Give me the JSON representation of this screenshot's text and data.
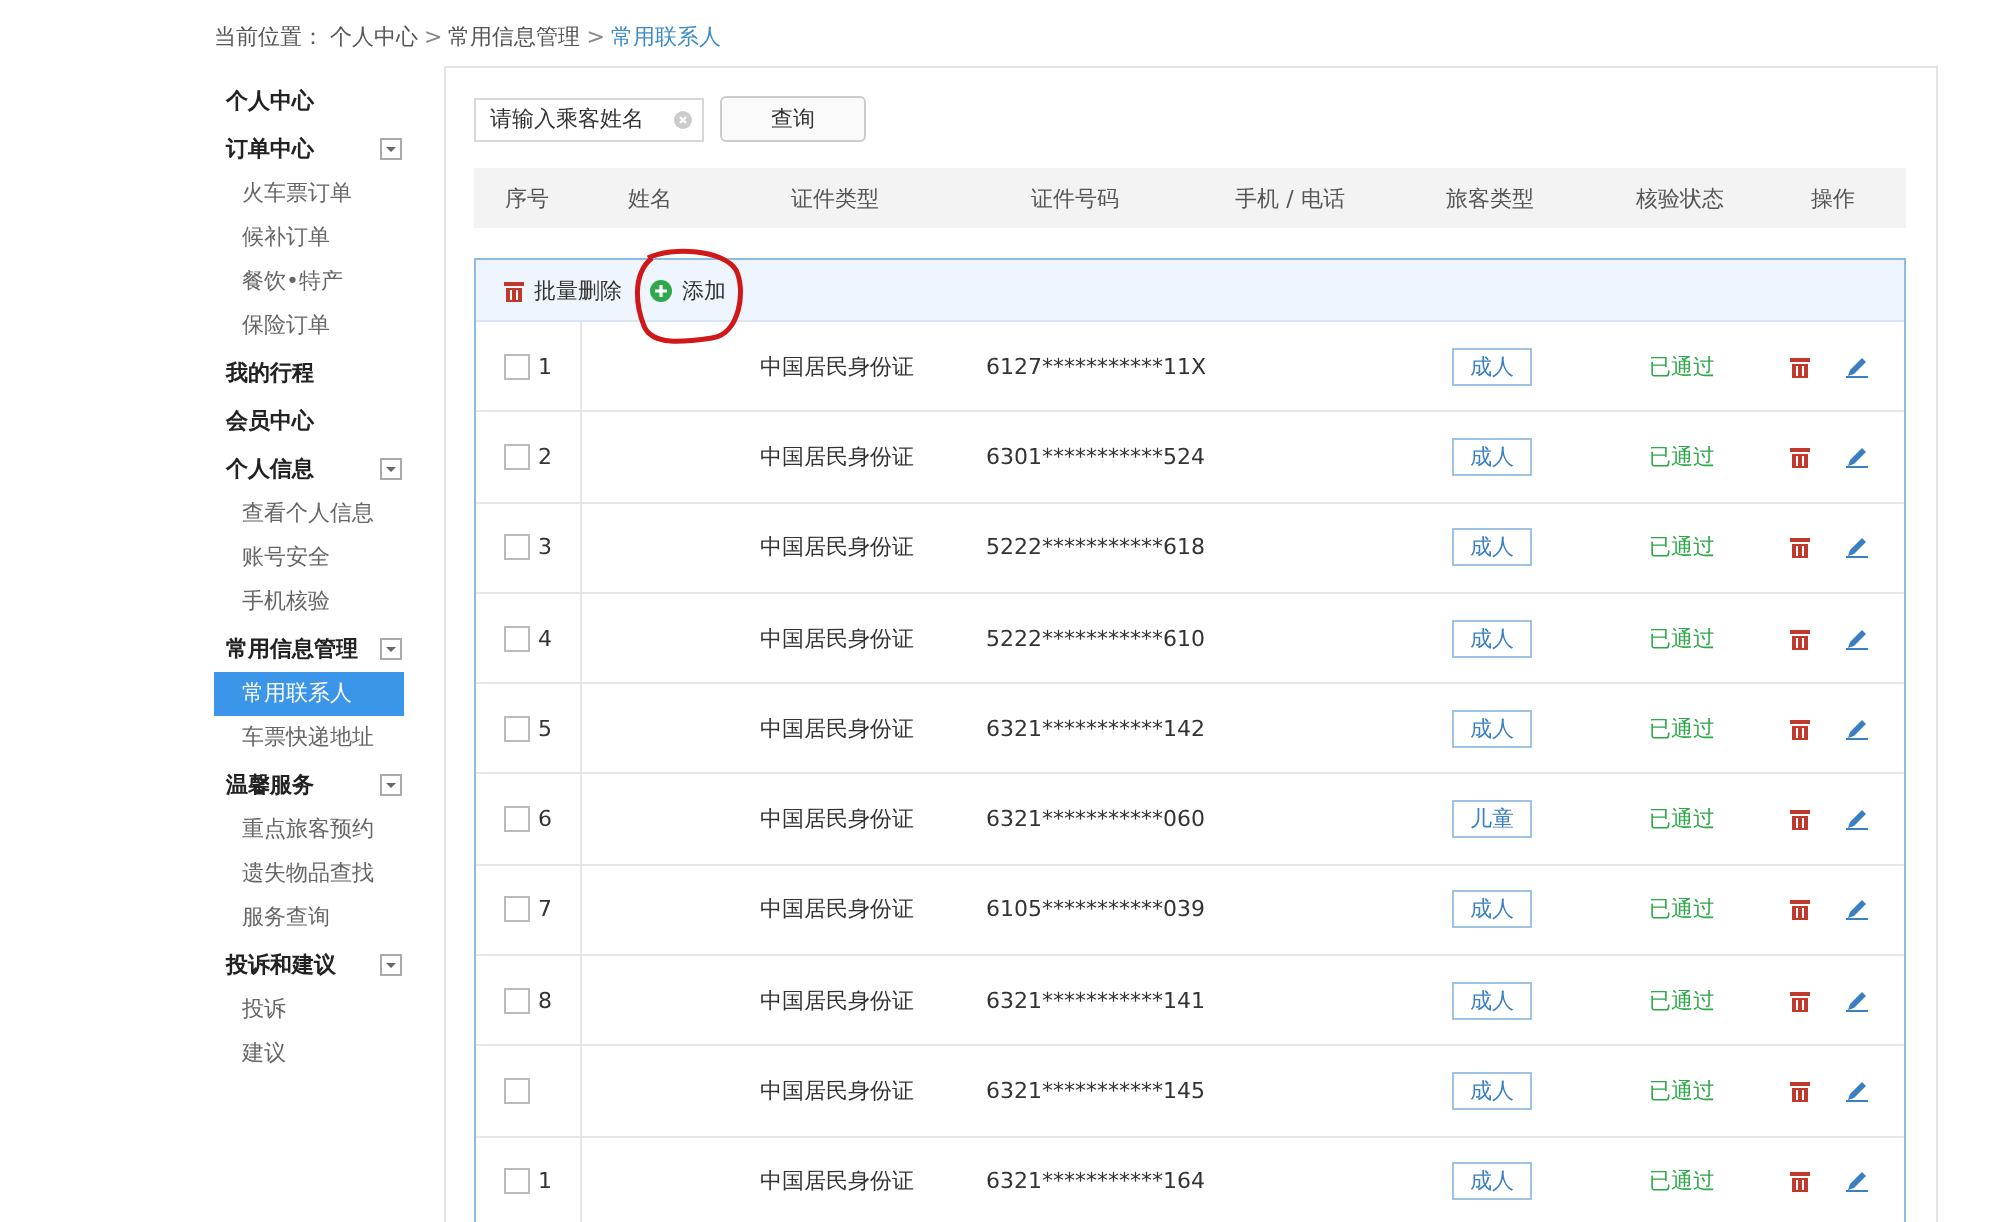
{
  "breadcrumb": {
    "label": "当前位置：",
    "items": [
      {
        "text": "个人中心",
        "current": false
      },
      {
        "text": "常用信息管理",
        "current": false
      },
      {
        "text": "常用联系人",
        "current": true
      }
    ],
    "separator": ">"
  },
  "sidebar": [
    {
      "label": "个人中心",
      "selected": false
    },
    {
      "label": "订单中心",
      "selected": false,
      "expanded": true,
      "children": [
        {
          "label": "火车票订单",
          "selected": false
        },
        {
          "label": "候补订单",
          "selected": false
        },
        {
          "label": "餐饮•特产",
          "selected": false
        },
        {
          "label": "保险订单",
          "selected": false
        }
      ]
    },
    {
      "label": "我的行程",
      "selected": false
    },
    {
      "label": "会员中心",
      "selected": false
    },
    {
      "label": "个人信息",
      "selected": false,
      "expanded": true,
      "children": [
        {
          "label": "查看个人信息",
          "selected": false
        },
        {
          "label": "账号安全",
          "selected": false
        },
        {
          "label": "手机核验",
          "selected": false
        }
      ]
    },
    {
      "label": "常用信息管理",
      "selected": false,
      "expanded": true,
      "children": [
        {
          "label": "常用联系人",
          "selected": true
        },
        {
          "label": "车票快递地址",
          "selected": false
        }
      ]
    },
    {
      "label": "温馨服务",
      "selected": false,
      "expanded": true,
      "children": [
        {
          "label": "重点旅客预约",
          "selected": false
        },
        {
          "label": "遗失物品查找",
          "selected": false
        },
        {
          "label": "服务查询",
          "selected": false
        }
      ]
    },
    {
      "label": "投诉和建议",
      "selected": false,
      "expanded": true,
      "children": [
        {
          "label": "投诉",
          "selected": false
        },
        {
          "label": "建议",
          "selected": false
        }
      ]
    }
  ],
  "search": {
    "placeholder": "请输入乘客姓名",
    "button": "查询"
  },
  "table": {
    "columns": [
      "序号",
      "姓名",
      "证件类型",
      "证件号码",
      "手机 / 电话",
      "旅客类型",
      "核验状态",
      "操作"
    ],
    "toolbar": {
      "delete": "批量删除",
      "add": "添加",
      "add_circled": true
    },
    "rows": [
      {
        "no": "1",
        "checked": false,
        "id_type": "中国居民身份证",
        "id_number": "6127***********11X",
        "passenger_type": "成人",
        "status": "已通过"
      },
      {
        "no": "2",
        "checked": false,
        "id_type": "中国居民身份证",
        "id_number": "6301***********524",
        "passenger_type": "成人",
        "status": "已通过"
      },
      {
        "no": "3",
        "checked": false,
        "id_type": "中国居民身份证",
        "id_number": "5222***********618",
        "passenger_type": "成人",
        "status": "已通过"
      },
      {
        "no": "4",
        "checked": false,
        "id_type": "中国居民身份证",
        "id_number": "5222***********610",
        "passenger_type": "成人",
        "status": "已通过"
      },
      {
        "no": "5",
        "checked": false,
        "id_type": "中国居民身份证",
        "id_number": "6321***********142",
        "passenger_type": "成人",
        "status": "已通过"
      },
      {
        "no": "6",
        "checked": false,
        "id_type": "中国居民身份证",
        "id_number": "6321***********060",
        "passenger_type": "儿童",
        "status": "已通过"
      },
      {
        "no": "7",
        "checked": false,
        "id_type": "中国居民身份证",
        "id_number": "6105***********039",
        "passenger_type": "成人",
        "status": "已通过"
      },
      {
        "no": "8",
        "checked": false,
        "id_type": "中国居民身份证",
        "id_number": "6321***********141",
        "passenger_type": "成人",
        "status": "已通过"
      },
      {
        "checked": false,
        "id_type": "中国居民身份证",
        "id_number": "6321***********145",
        "passenger_type": "成人",
        "status": "已通过"
      },
      {
        "no": "1",
        "checked": false,
        "id_type": "中国居民身份证",
        "id_number": "6321***********164",
        "passenger_type": "成人",
        "status": "已通过"
      }
    ]
  }
}
